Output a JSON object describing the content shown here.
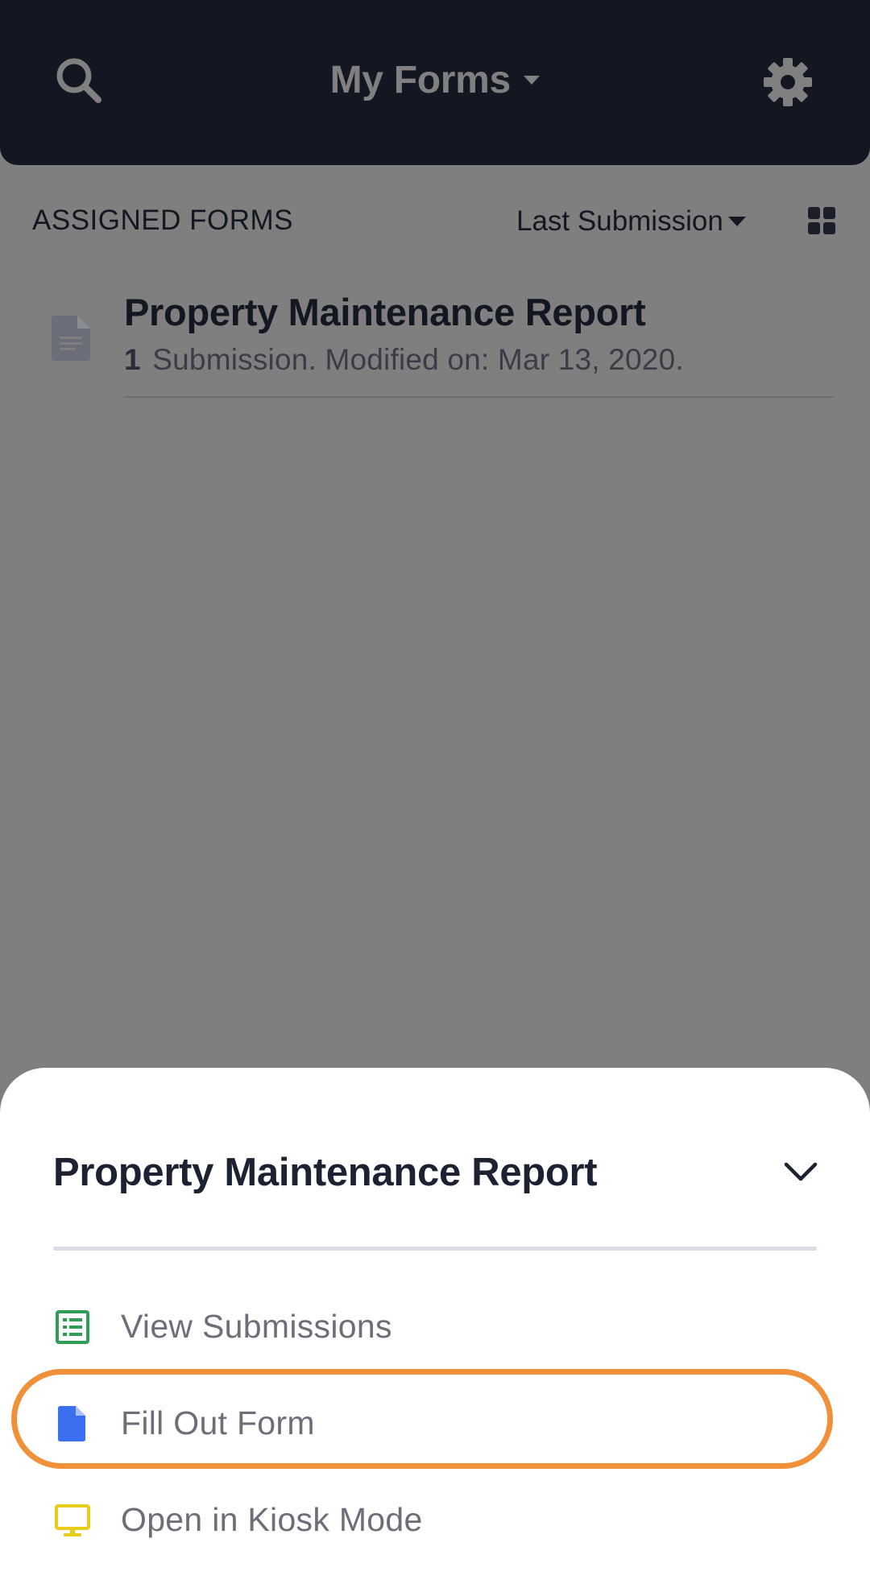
{
  "header": {
    "title": "My Forms",
    "search_icon": "search-icon",
    "settings_icon": "gear-icon",
    "background_color": "#131722"
  },
  "toolbar": {
    "section_label": "ASSIGNED FORMS",
    "sort_label": "Last Submission",
    "view_toggle_icon": "grid-view-icon"
  },
  "forms": [
    {
      "title": "Property Maintenance Report",
      "submission_count": "1",
      "meta_text": "Submission. Modified on: Mar 13, 2020.",
      "icon": "document-icon"
    }
  ],
  "sheet": {
    "title": "Property Maintenance Report",
    "collapse_icon": "chevron-down-icon",
    "items": [
      {
        "label": "View Submissions",
        "icon": "table-icon",
        "icon_color": "#2e9e57"
      },
      {
        "label": "Fill Out Form",
        "icon": "document-icon",
        "icon_color": "#3b6ff0",
        "highlighted": true
      },
      {
        "label": "Open in Kiosk Mode",
        "icon": "monitor-icon",
        "icon_color": "#e8cc1a"
      }
    ],
    "highlight_color": "#f0913a"
  }
}
